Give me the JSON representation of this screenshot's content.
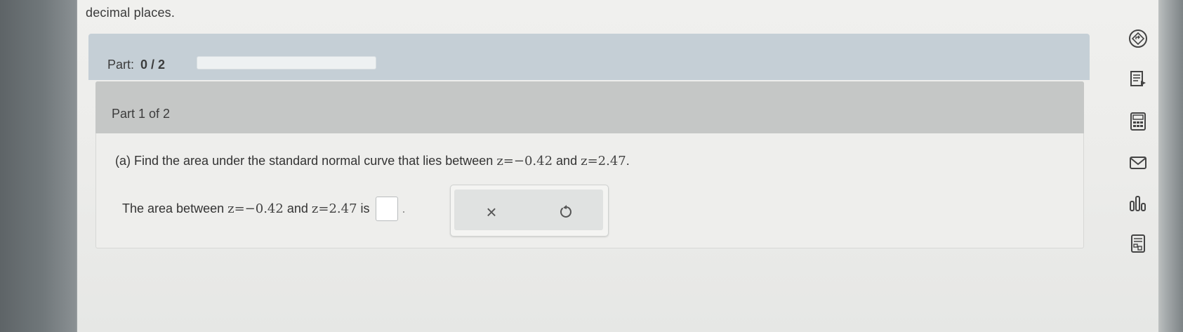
{
  "question": {
    "instruction": "decimal places.",
    "part_label": "Part:",
    "part_progress": "0 / 2",
    "progress_fraction": 0,
    "part_title": "Part 1 of 2",
    "prompt_prefix": "(a) Find the area under the standard normal curve that lies between ",
    "z1_expr": "z=−0.42",
    "and_word": " and ",
    "z2_expr": "z=2.47",
    "prompt_suffix": ".",
    "answer_prefix": "The area between ",
    "answer_is": " is",
    "answer_suffix": "."
  },
  "actions": {
    "clear_symbol": "×",
    "undo_icon": "undo-icon"
  },
  "sidebar": {
    "icons": [
      "navigate-icon",
      "reading-icon",
      "calculator-icon",
      "mail-icon",
      "chart-icon",
      "table-icon"
    ]
  },
  "colors": {
    "part_bar": "#c5cfd6",
    "card_header": "#c5c7c6",
    "accent": "#2b7fc2"
  }
}
